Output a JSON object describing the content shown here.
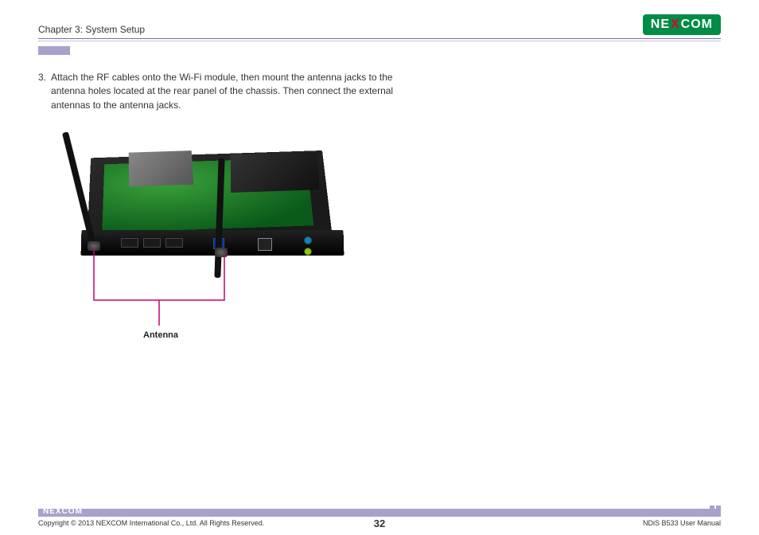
{
  "header": {
    "chapter_title": "Chapter 3: System Setup",
    "logo_pre": "NE",
    "logo_x": "X",
    "logo_post": "COM"
  },
  "content": {
    "step_number": "3.",
    "step_text": "Attach the RF cables onto the Wi-Fi module, then mount the antenna jacks to the antenna holes located at the rear panel of the chassis. Then connect the external antennas to the antenna jacks.",
    "callout_label": "Antenna"
  },
  "footer": {
    "logo_pre": "NE",
    "logo_x": "X",
    "logo_post": "COM",
    "copyright": "Copyright © 2013 NEXCOM International Co., Ltd. All Rights Reserved.",
    "page_number": "32",
    "doc_ref": "NDiS B533 User Manual"
  }
}
